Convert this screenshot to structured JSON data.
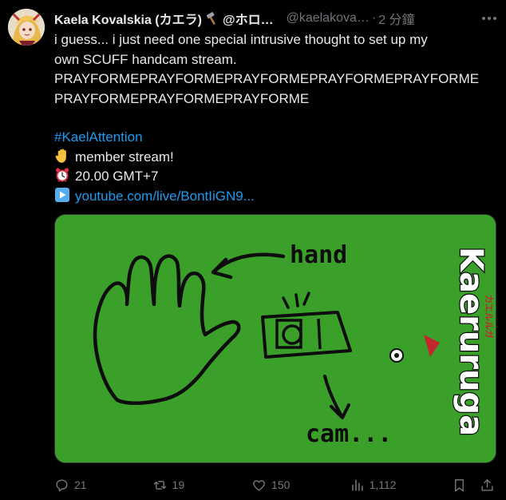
{
  "post": {
    "author_name": "Kaela Kovalskia (カエラ)",
    "author_handle_display": "@ホロ…",
    "handle": "@kaelakova…",
    "time": "2 分鐘",
    "lines": [
      "i guess... i just need one special intrusive thought to set up my",
      "own SCUFF handcam stream.",
      "PRAYFORMEPRAYFORMEPRAYFORMEPRAYFORMEPRAYFORME",
      "PRAYFORMEPRAYFORMEPRAYFORME"
    ],
    "hashtag": "#KaelAttention",
    "member_line": "member stream!",
    "time_line": "20.00 GMT+7",
    "link": "youtube.com/live/BontIiGN9..."
  },
  "media": {
    "background_color": "#3aa02a",
    "label_hand": "hand",
    "label_cam": "cam...",
    "logo_text": "Kaeruruga",
    "logo_sub": "カエルルガ"
  },
  "actions": {
    "replies": "21",
    "reposts": "19",
    "likes": "150",
    "views": "1,112"
  },
  "colors": {
    "text": "#e7e9ea",
    "muted": "#71767b",
    "link": "#1d9bf0"
  }
}
